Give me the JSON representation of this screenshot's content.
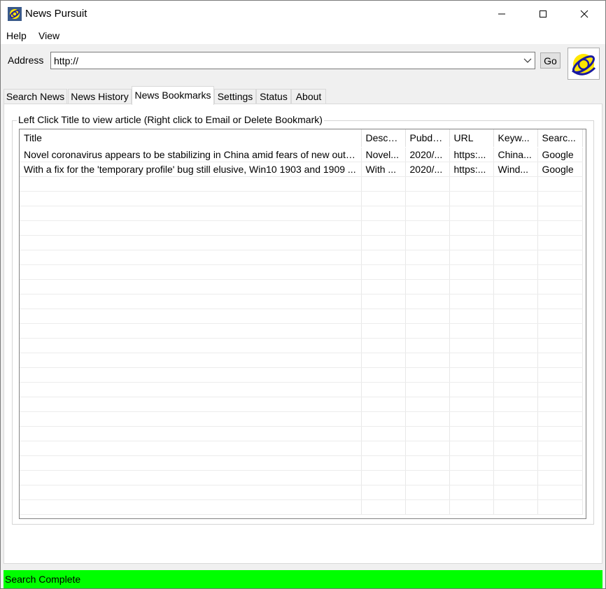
{
  "window": {
    "title": "News Pursuit",
    "minimize_icon": "minimize-icon",
    "maximize_icon": "maximize-icon",
    "close_icon": "close-icon"
  },
  "menu": {
    "items": [
      {
        "label": "Help"
      },
      {
        "label": "View"
      }
    ]
  },
  "address": {
    "label": "Address",
    "value": "http://",
    "go_label": "Go"
  },
  "tabs": [
    {
      "label": "Search News",
      "active": false
    },
    {
      "label": "News History",
      "active": false
    },
    {
      "label": "News Bookmarks",
      "active": true
    },
    {
      "label": "Settings",
      "active": false
    },
    {
      "label": "Status",
      "active": false
    },
    {
      "label": "About",
      "active": false
    }
  ],
  "bookmarks": {
    "group_label": "Left Click Title to view article (Right click to Email or Delete Bookmark)",
    "columns": [
      "Title",
      "Descri...",
      "Pubdate",
      "URL",
      "Keyw...",
      "Searc..."
    ],
    "rows": [
      [
        "Novel coronavirus appears to be stabilizing in China amid fears of new outbre...",
        "Novel...",
        "2020/...",
        "https:...",
        "China...",
        "Google"
      ],
      [
        "With a fix for the 'temporary profile' bug still elusive, Win10 1903 and 1909 ...",
        "With ...",
        "2020/...",
        "https:...",
        "Wind...",
        "Google"
      ]
    ]
  },
  "status": {
    "text": "Search Complete",
    "color": "#00ff00"
  },
  "colors": {
    "logo_yellow": "#ffe600",
    "logo_blue": "#1a1aa0"
  }
}
